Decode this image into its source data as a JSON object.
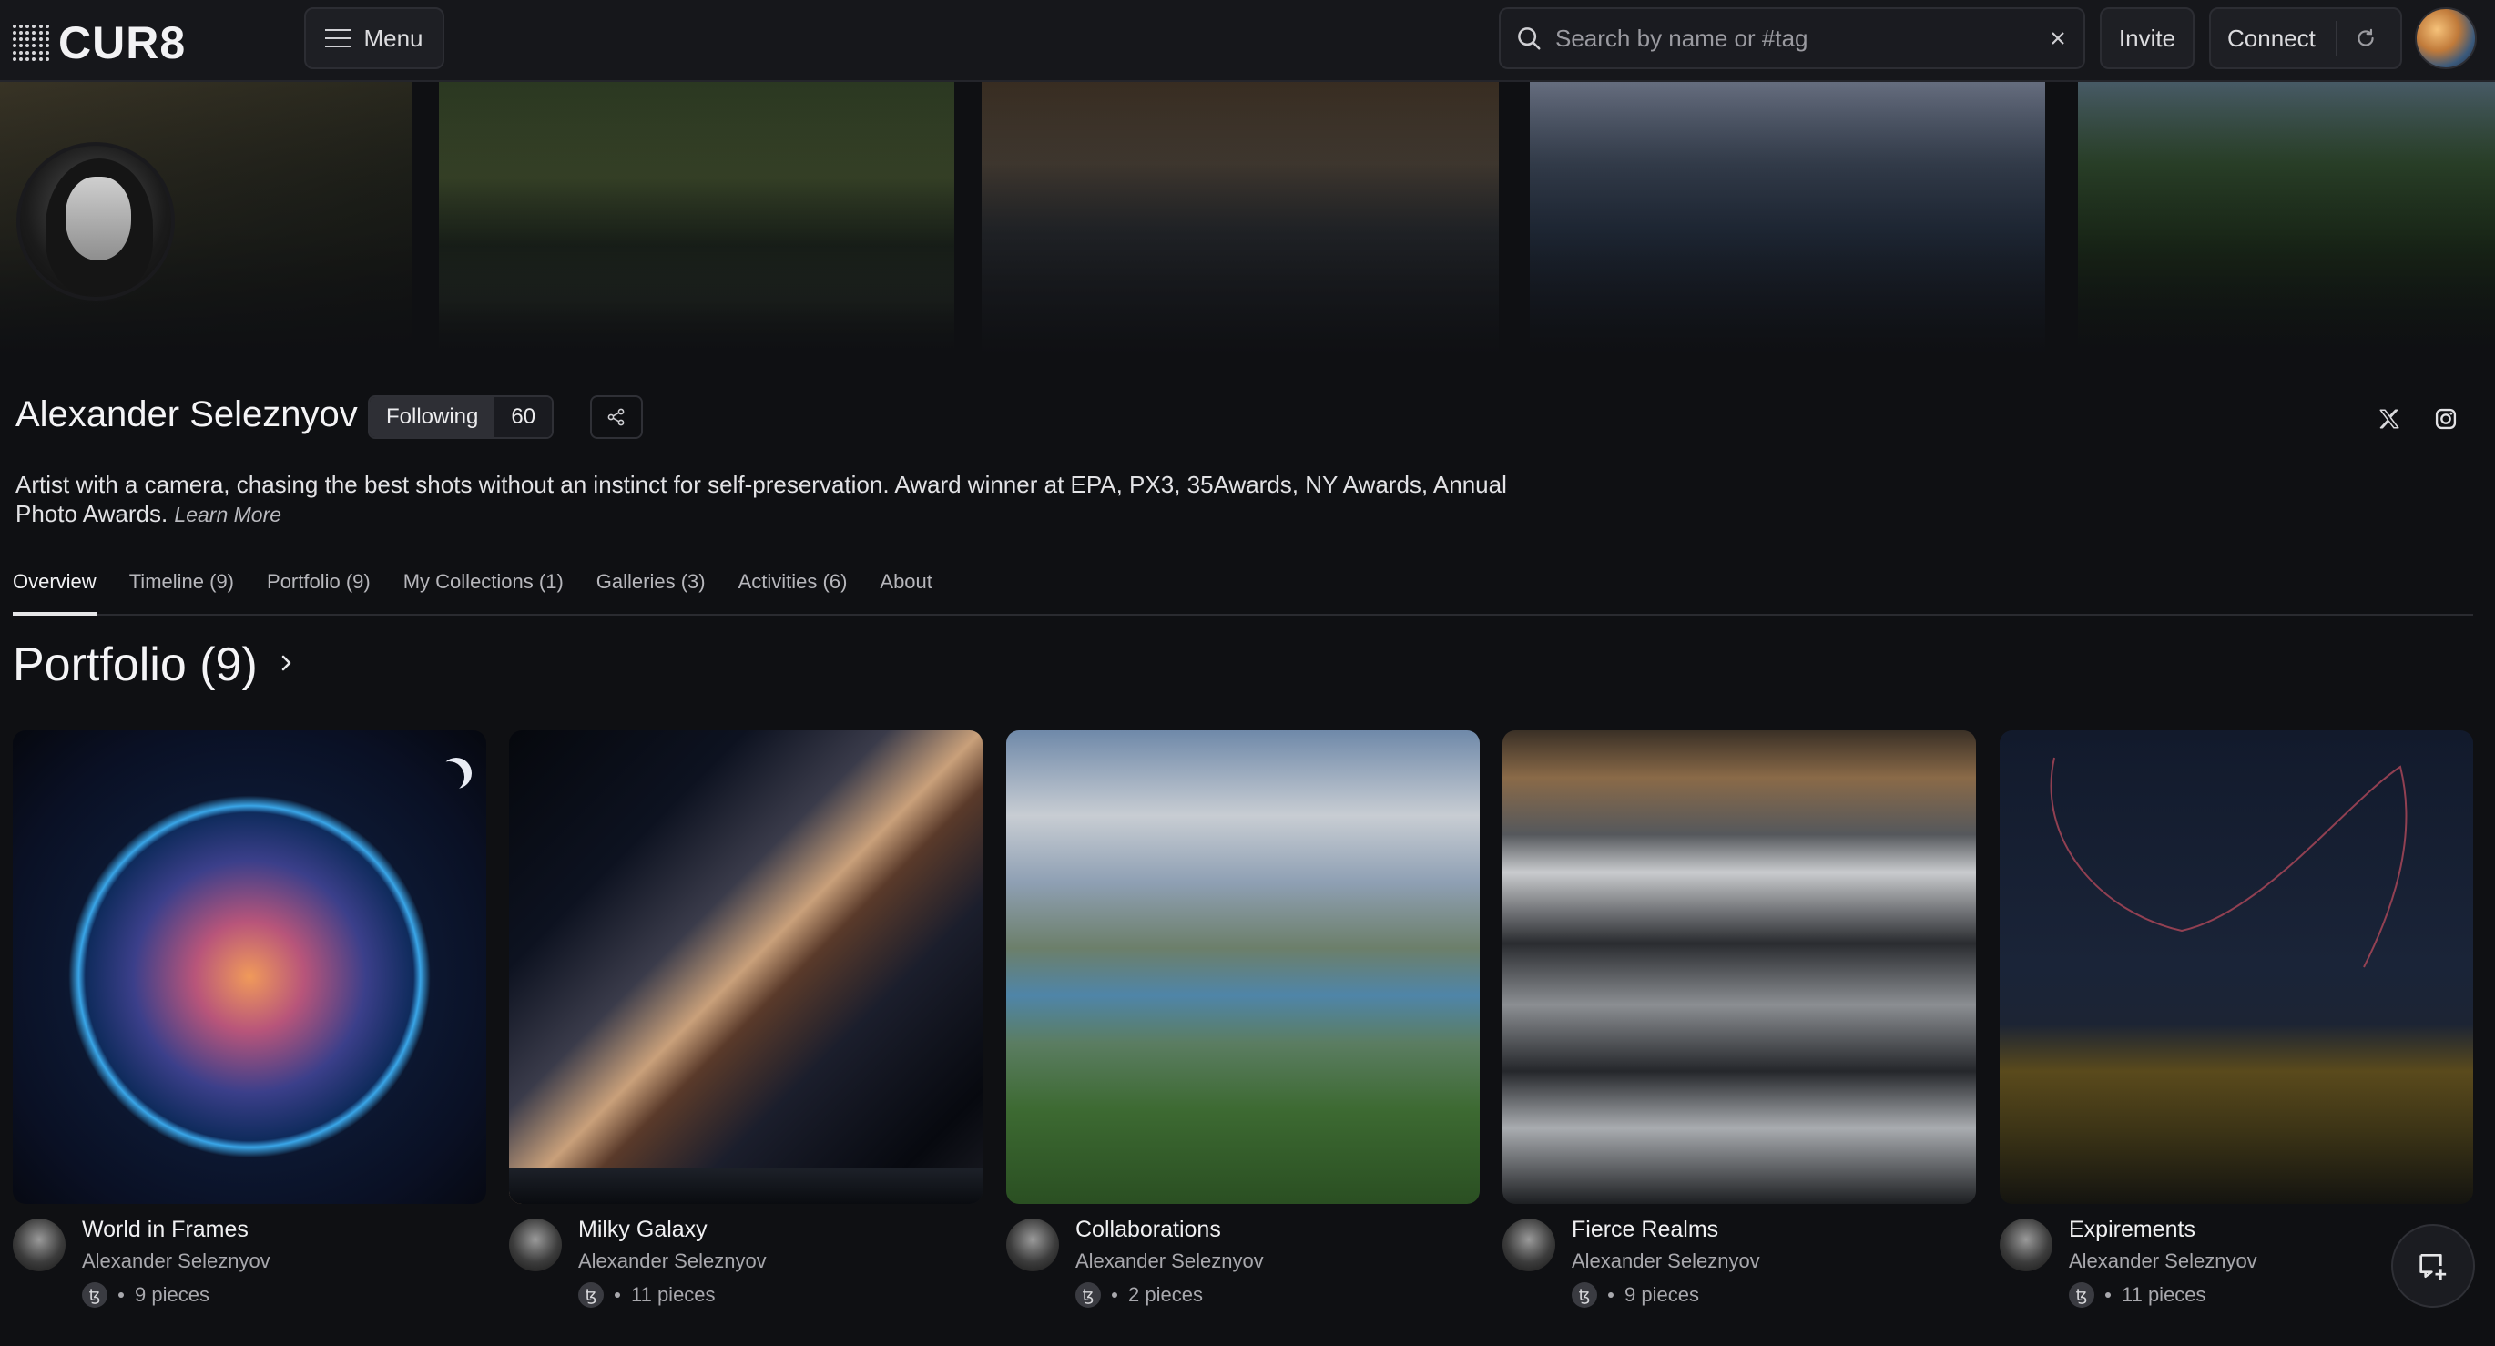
{
  "app": {
    "logo": "CUR8"
  },
  "topbar": {
    "menu_label": "Menu",
    "search_placeholder": "Search by name or #tag",
    "invite_label": "Invite",
    "connect_label": "Connect"
  },
  "profile": {
    "name": "Alexander Seleznyov",
    "following_label": "Following",
    "following_count": "60",
    "bio": "Artist with a camera, chasing the best shots without an instinct for self-preservation. Award winner at EPA, PX3, 35Awards, NY Awards, Annual Photo Awards.",
    "learn_more": "Learn More"
  },
  "tabs": [
    {
      "label": "Overview",
      "active": true
    },
    {
      "label": "Timeline (9)"
    },
    {
      "label": "Portfolio (9)"
    },
    {
      "label": "My Collections (1)"
    },
    {
      "label": "Galleries (3)"
    },
    {
      "label": "Activities (6)"
    },
    {
      "label": "About"
    }
  ],
  "section": {
    "title": "Portfolio (9)"
  },
  "cards": [
    {
      "title": "World in Frames",
      "author": "Alexander Seleznyov",
      "pieces": "9 pieces"
    },
    {
      "title": "Milky Galaxy",
      "author": "Alexander Seleznyov",
      "pieces": "11 pieces"
    },
    {
      "title": "Collaborations",
      "author": "Alexander Seleznyov",
      "pieces": "2 pieces"
    },
    {
      "title": "Fierce Realms",
      "author": "Alexander Seleznyov",
      "pieces": "9 pieces"
    },
    {
      "title": "Expirements",
      "author": "Alexander Seleznyov",
      "pieces": "11 pieces"
    }
  ],
  "icons": [
    "hamburger-icon",
    "search-icon",
    "clear-icon",
    "refresh-icon",
    "share-icon",
    "x-icon",
    "instagram-icon",
    "chevron-right-icon",
    "tezos-icon",
    "add-collection-icon"
  ],
  "colors": {
    "background": "#0f1013",
    "topbar": "#16171b",
    "text": "#e8e8ea",
    "muted": "#a8a8ad"
  }
}
